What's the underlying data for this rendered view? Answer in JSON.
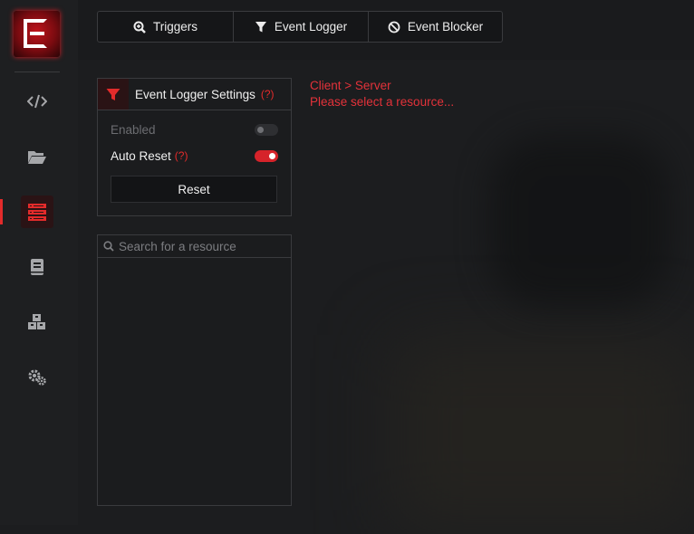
{
  "sidebar": {
    "items": [
      {
        "icon": "code-icon"
      },
      {
        "icon": "folder-open-icon"
      },
      {
        "icon": "list-icon",
        "active": true
      },
      {
        "icon": "book-icon"
      },
      {
        "icon": "cubes-icon"
      },
      {
        "icon": "gears-icon"
      }
    ]
  },
  "tabs": [
    {
      "label": "Triggers",
      "icon": "search-plus-icon"
    },
    {
      "label": "Event Logger",
      "icon": "filter-icon"
    },
    {
      "label": "Event Blocker",
      "icon": "ban-icon"
    }
  ],
  "settings": {
    "title": "Event Logger Settings",
    "help": "(?)",
    "enabled_label": "Enabled",
    "enabled": false,
    "auto_reset_label": "Auto Reset",
    "auto_reset_help": "(?)",
    "auto_reset": true,
    "reset_label": "Reset"
  },
  "search": {
    "placeholder": "Search for a resource"
  },
  "status": {
    "direction": "Client > Server",
    "message": "Please select a resource..."
  },
  "colors": {
    "accent": "#e32b2b",
    "background": "#1c1d1f",
    "panel_border": "#3a3b3e"
  }
}
